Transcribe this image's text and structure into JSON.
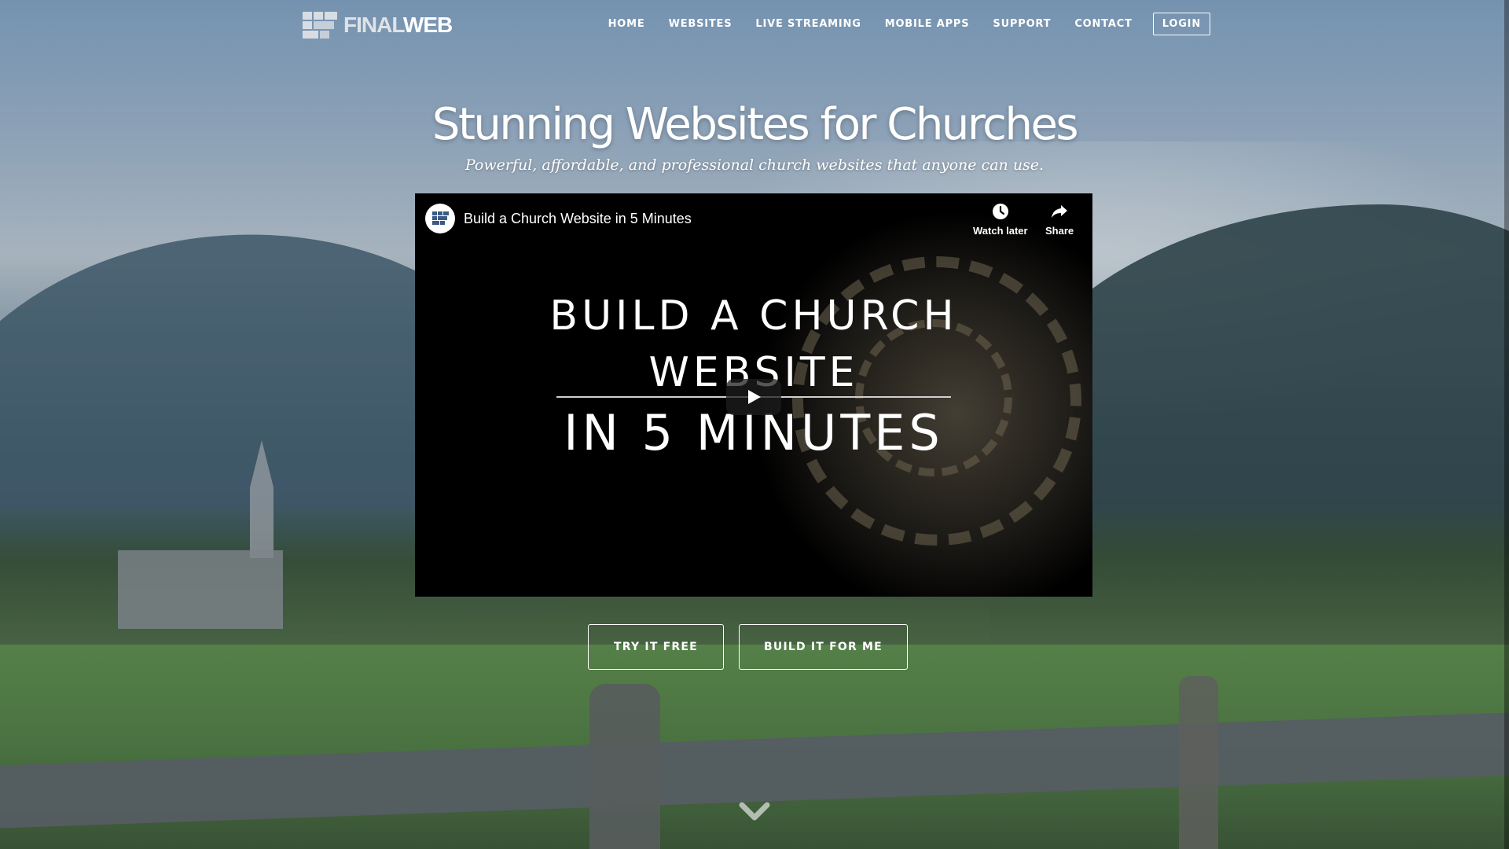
{
  "brand": {
    "logo_part1": "FINAL",
    "logo_part2": "WEB"
  },
  "nav": {
    "items": [
      "HOME",
      "WEBSITES",
      "LIVE STREAMING",
      "MOBILE APPS",
      "SUPPORT",
      "CONTACT"
    ],
    "login_label": "LOGIN"
  },
  "hero": {
    "title": "Stunning Websites for Churches",
    "subtitle": "Powerful, affordable, and professional church websites that anyone can use."
  },
  "video": {
    "title": "Build a Church Website in 5 Minutes",
    "watch_later_label": "Watch later",
    "share_label": "Share",
    "thumb_line1": "BUILD A CHURCH",
    "thumb_line2": "WEBSITE",
    "thumb_line3": "IN 5 MINUTES",
    "icons": {
      "watch_later": "clock-icon",
      "share": "share-arrow-icon",
      "play": "play-icon"
    }
  },
  "cta": {
    "try_label": "TRY IT FREE",
    "build_label": "BUILD IT FOR ME"
  },
  "scroll": {
    "icon": "chevron-down-icon"
  },
  "colors": {
    "text": "#ffffff",
    "video_bg": "#000000",
    "logo_mark": "#d7dde3"
  }
}
